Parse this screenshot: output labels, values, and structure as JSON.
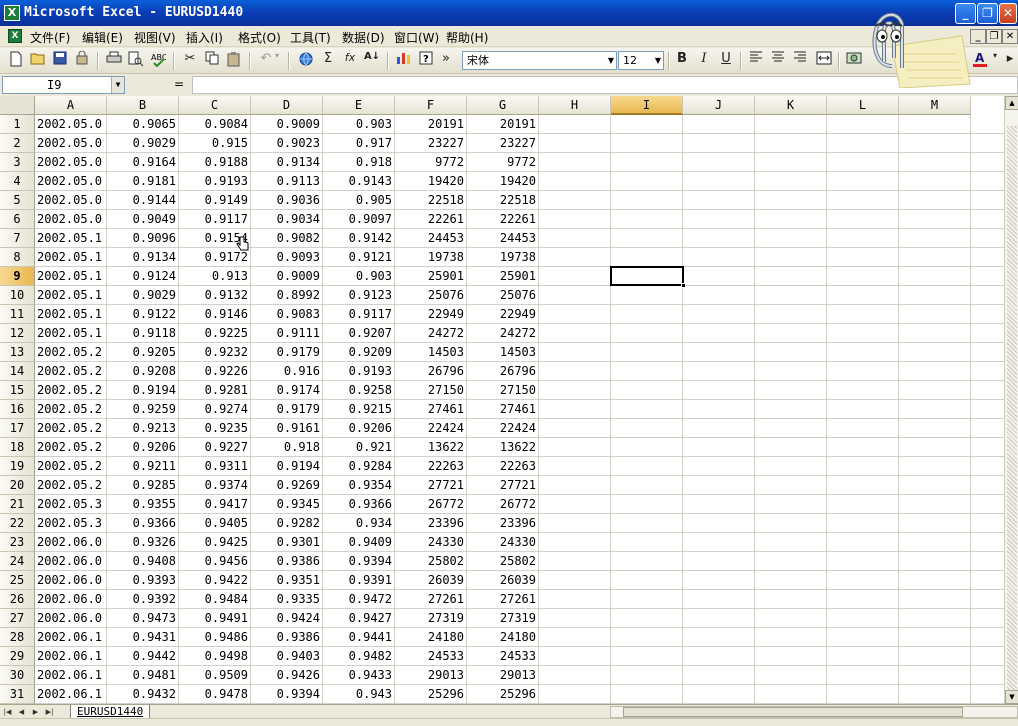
{
  "window": {
    "title": "Microsoft Excel - EURUSD1440",
    "app_icon": "X",
    "controls": {
      "minimize": "_",
      "maximize": "❐",
      "close": "✕"
    }
  },
  "menubar": {
    "items": [
      "文件(F)",
      "编辑(E)",
      "视图(V)",
      "插入(I)",
      "格式(O)",
      "工具(T)",
      "数据(D)",
      "窗口(W)",
      "帮助(H)"
    ]
  },
  "toolbar": {
    "font_name": "宋体",
    "font_size": "12",
    "bold_label": "B",
    "italic_label": "I",
    "underline_label": "U",
    "sum_label": "Σ",
    "fx_label": "fx",
    "sort_label": "A↓",
    "more_label": "»"
  },
  "formula_bar": {
    "name_box": "I9",
    "equals": "=",
    "content": ""
  },
  "grid": {
    "columns": [
      "A",
      "B",
      "C",
      "D",
      "E",
      "F",
      "G",
      "H",
      "I",
      "J",
      "K",
      "L",
      "M"
    ],
    "selected_column": "I",
    "selected_row": 9,
    "rows": [
      [
        "1",
        "2002.05.0",
        "0.9065",
        "0.9084",
        "0.9009",
        "0.903",
        "20191",
        "20191"
      ],
      [
        "2",
        "2002.05.0",
        "0.9029",
        "0.915",
        "0.9023",
        "0.917",
        "23227",
        "23227"
      ],
      [
        "3",
        "2002.05.0",
        "0.9164",
        "0.9188",
        "0.9134",
        "0.918",
        "9772",
        "9772"
      ],
      [
        "4",
        "2002.05.0",
        "0.9181",
        "0.9193",
        "0.9113",
        "0.9143",
        "19420",
        "19420"
      ],
      [
        "5",
        "2002.05.0",
        "0.9144",
        "0.9149",
        "0.9036",
        "0.905",
        "22518",
        "22518"
      ],
      [
        "6",
        "2002.05.0",
        "0.9049",
        "0.9117",
        "0.9034",
        "0.9097",
        "22261",
        "22261"
      ],
      [
        "7",
        "2002.05.1",
        "0.9096",
        "0.9154",
        "0.9082",
        "0.9142",
        "24453",
        "24453"
      ],
      [
        "8",
        "2002.05.1",
        "0.9134",
        "0.9172",
        "0.9093",
        "0.9121",
        "19738",
        "19738"
      ],
      [
        "9",
        "2002.05.1",
        "0.9124",
        "0.913",
        "0.9009",
        "0.903",
        "25901",
        "25901"
      ],
      [
        "10",
        "2002.05.1",
        "0.9029",
        "0.9132",
        "0.8992",
        "0.9123",
        "25076",
        "25076"
      ],
      [
        "11",
        "2002.05.1",
        "0.9122",
        "0.9146",
        "0.9083",
        "0.9117",
        "22949",
        "22949"
      ],
      [
        "12",
        "2002.05.1",
        "0.9118",
        "0.9225",
        "0.9111",
        "0.9207",
        "24272",
        "24272"
      ],
      [
        "13",
        "2002.05.2",
        "0.9205",
        "0.9232",
        "0.9179",
        "0.9209",
        "14503",
        "14503"
      ],
      [
        "14",
        "2002.05.2",
        "0.9208",
        "0.9226",
        "0.916",
        "0.9193",
        "26796",
        "26796"
      ],
      [
        "15",
        "2002.05.2",
        "0.9194",
        "0.9281",
        "0.9174",
        "0.9258",
        "27150",
        "27150"
      ],
      [
        "16",
        "2002.05.2",
        "0.9259",
        "0.9274",
        "0.9179",
        "0.9215",
        "27461",
        "27461"
      ],
      [
        "17",
        "2002.05.2",
        "0.9213",
        "0.9235",
        "0.9161",
        "0.9206",
        "22424",
        "22424"
      ],
      [
        "18",
        "2002.05.2",
        "0.9206",
        "0.9227",
        "0.918",
        "0.921",
        "13622",
        "13622"
      ],
      [
        "19",
        "2002.05.2",
        "0.9211",
        "0.9311",
        "0.9194",
        "0.9284",
        "22263",
        "22263"
      ],
      [
        "20",
        "2002.05.2",
        "0.9285",
        "0.9374",
        "0.9269",
        "0.9354",
        "27721",
        "27721"
      ],
      [
        "21",
        "2002.05.3",
        "0.9355",
        "0.9417",
        "0.9345",
        "0.9366",
        "26772",
        "26772"
      ],
      [
        "22",
        "2002.05.3",
        "0.9366",
        "0.9405",
        "0.9282",
        "0.934",
        "23396",
        "23396"
      ],
      [
        "23",
        "2002.06.0",
        "0.9326",
        "0.9425",
        "0.9301",
        "0.9409",
        "24330",
        "24330"
      ],
      [
        "24",
        "2002.06.0",
        "0.9408",
        "0.9456",
        "0.9386",
        "0.9394",
        "25802",
        "25802"
      ],
      [
        "25",
        "2002.06.0",
        "0.9393",
        "0.9422",
        "0.9351",
        "0.9391",
        "26039",
        "26039"
      ],
      [
        "26",
        "2002.06.0",
        "0.9392",
        "0.9484",
        "0.9335",
        "0.9472",
        "27261",
        "27261"
      ],
      [
        "27",
        "2002.06.0",
        "0.9473",
        "0.9491",
        "0.9424",
        "0.9427",
        "27319",
        "27319"
      ],
      [
        "28",
        "2002.06.1",
        "0.9431",
        "0.9486",
        "0.9386",
        "0.9441",
        "24180",
        "24180"
      ],
      [
        "29",
        "2002.06.1",
        "0.9442",
        "0.9498",
        "0.9403",
        "0.9482",
        "24533",
        "24533"
      ],
      [
        "30",
        "2002.06.1",
        "0.9481",
        "0.9509",
        "0.9426",
        "0.9433",
        "29013",
        "29013"
      ],
      [
        "31",
        "2002.06.1",
        "0.9432",
        "0.9478",
        "0.9394",
        "0.943",
        "25296",
        "25296"
      ]
    ]
  },
  "sheet_tabs": [
    "EURUSD1440"
  ],
  "colors": {
    "titlebar": "#0a3fb8",
    "selected_header": "#e8b850",
    "gridline": "#d4d0c8",
    "excel_green": "#1a7d3a"
  }
}
